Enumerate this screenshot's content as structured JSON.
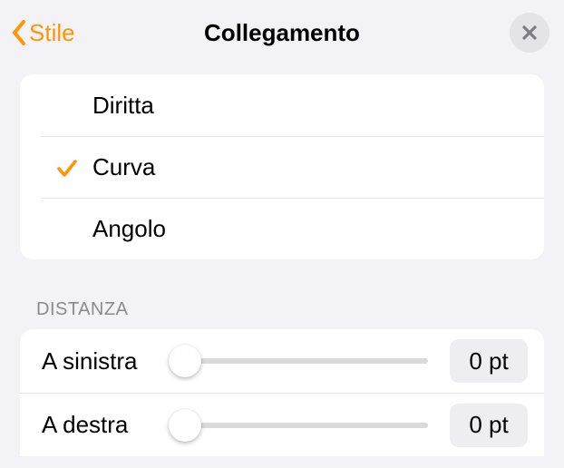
{
  "header": {
    "back_label": "Stile",
    "title": "Collegamento"
  },
  "line_types": {
    "items": [
      {
        "label": "Diritta",
        "selected": false
      },
      {
        "label": "Curva",
        "selected": true
      },
      {
        "label": "Angolo",
        "selected": false
      }
    ]
  },
  "distance": {
    "section_title": "DISTANZA",
    "rows": [
      {
        "label": "A sinistra",
        "value_display": "0 pt",
        "value": 0
      },
      {
        "label": "A destra",
        "value_display": "0 pt",
        "value": 0
      }
    ]
  },
  "colors": {
    "accent": "#ff9500"
  }
}
